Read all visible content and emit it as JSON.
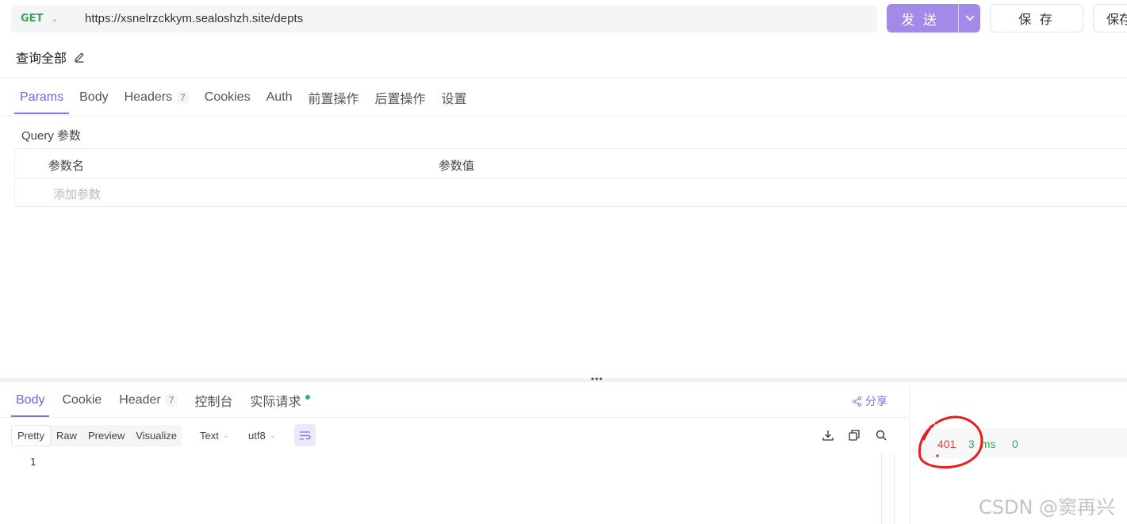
{
  "request": {
    "method": "GET",
    "url": "https://xsnelrzckkym.sealoshzh.site/depts",
    "send_label": "发 送",
    "save_label": "保 存",
    "save_as_label": "保存",
    "name": "查询全部"
  },
  "req_tabs": [
    {
      "label": "Params"
    },
    {
      "label": "Body"
    },
    {
      "label": "Headers",
      "count": "7"
    },
    {
      "label": "Cookies"
    },
    {
      "label": "Auth"
    },
    {
      "label": "前置操作"
    },
    {
      "label": "后置操作"
    },
    {
      "label": "设置"
    }
  ],
  "params": {
    "section_label": "Query 参数",
    "col_name": "参数名",
    "col_value": "参数值",
    "add_placeholder": "添加参数"
  },
  "res_tabs": [
    {
      "label": "Body"
    },
    {
      "label": "Cookie"
    },
    {
      "label": "Header",
      "count": "7"
    },
    {
      "label": "控制台"
    },
    {
      "label": "实际请求"
    }
  ],
  "share_label": "分享",
  "body_toolbar": {
    "formats": [
      "Pretty",
      "Raw",
      "Preview",
      "Visualize"
    ],
    "type_select": "Text",
    "encoding_select": "utf8"
  },
  "editor": {
    "line_number": "1"
  },
  "status": {
    "code": "401",
    "time": "3",
    "time_unit": "ms",
    "size": "0"
  },
  "watermark": "CSDN @窦再兴",
  "colors": {
    "accent": "#8a6ee0",
    "method": "#3da35d",
    "error": "#e0443a"
  }
}
